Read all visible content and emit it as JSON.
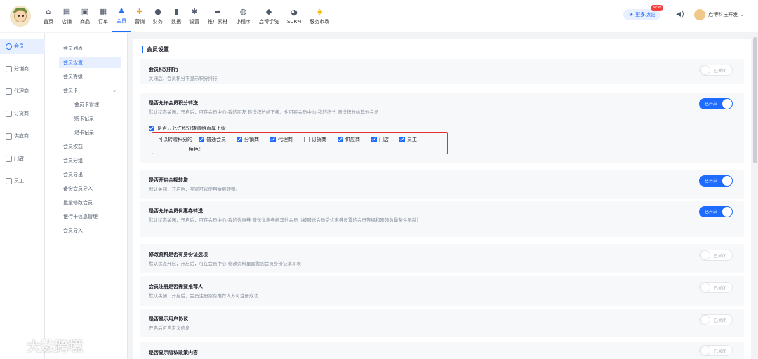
{
  "nav": [
    {
      "icon": "home-icon",
      "glyph": "⌂",
      "label": "首页"
    },
    {
      "icon": "store-icon",
      "glyph": "▤",
      "label": "店铺"
    },
    {
      "icon": "goods-icon",
      "glyph": "▣",
      "label": "商品"
    },
    {
      "icon": "order-icon",
      "glyph": "▦",
      "label": "订单"
    },
    {
      "icon": "member-icon",
      "glyph": "♟",
      "label": "会员",
      "active": true
    },
    {
      "icon": "marketing-icon",
      "glyph": "✚",
      "label": "营销"
    },
    {
      "icon": "finance-icon",
      "glyph": "●",
      "label": "财务"
    },
    {
      "icon": "data-icon",
      "glyph": "▮",
      "label": "数据"
    },
    {
      "icon": "settings-icon",
      "glyph": "✱",
      "label": "设置"
    },
    {
      "icon": "promote-icon",
      "glyph": "➦",
      "label": "推广素材"
    },
    {
      "icon": "miniapp-icon",
      "glyph": "◍",
      "label": "小程序"
    },
    {
      "icon": "academy-icon",
      "glyph": "◆",
      "label": "启博学院"
    },
    {
      "icon": "scrm-icon",
      "glyph": "◕",
      "label": "SCRM"
    },
    {
      "icon": "service-market-icon",
      "glyph": "◈",
      "label": "服务市场"
    }
  ],
  "top_right": {
    "more_label": "更多功能",
    "new_badge": "NEW",
    "user_name": "启博科技开发"
  },
  "side1": [
    {
      "label": "会员",
      "active": true
    },
    {
      "label": "分销商"
    },
    {
      "label": "代理商"
    },
    {
      "label": "订货商"
    },
    {
      "label": "供应商"
    },
    {
      "label": "门店"
    },
    {
      "label": "员工"
    }
  ],
  "side2": [
    {
      "label": "会员列表"
    },
    {
      "label": "会员设置",
      "active": true
    },
    {
      "label": "会员等级"
    },
    {
      "label": "会员卡",
      "expandable": true
    },
    {
      "label": "会员卡管理",
      "sub": true
    },
    {
      "label": "购卡记录",
      "sub": true
    },
    {
      "label": "退卡记录",
      "sub": true
    },
    {
      "label": "会员权益"
    },
    {
      "label": "会员分组"
    },
    {
      "label": "会员导出"
    },
    {
      "label": "备份会员导入"
    },
    {
      "label": "批量修改会员"
    },
    {
      "label": "银行卡信息管理"
    },
    {
      "label": "会员导入"
    }
  ],
  "section_title": "会员设置",
  "toggle_on_label": "已开启",
  "toggle_off_label": "已关闭",
  "settings": [
    {
      "title": "会员积分排行",
      "desc": "关闭后，会员积分不显示积分排行",
      "on": false
    },
    {
      "title": "是否允许会员积分转送",
      "desc": "默认状态关闭，开启后，可在会员中心-我的朋友 转送积分给下级，也可在会员中心-我的积分 赠送积分给其他会员",
      "on": true
    },
    {
      "title": "是否开启余额转增",
      "desc": "默认关闭，开启后，买家可以使用余额转赠。",
      "on": true
    },
    {
      "title": "是否允许会员优惠券转送",
      "desc": "默认状态关闭，开启后，可在会员中心-我的优惠券 赠送优惠券给其他会员（被赠送会员受优惠券设置的会员等级和限领数量条件限制）",
      "on": true
    },
    {
      "title": "修改资料是否有身份证选项",
      "desc": "默认状态开启，开启后，可在会员中心-修改资料里面看到会员身份证填写项",
      "on": false
    },
    {
      "title": "会员注册是否需要推荐人",
      "desc": "默认关闭，开启后，会员注册需有推荐人方可注册成功",
      "on": false
    },
    {
      "title": "是否显示用户协议",
      "desc": "开启后可自定义信息",
      "on": false
    },
    {
      "title": "是否显示隐私政策内容",
      "desc": "",
      "on": false
    }
  ],
  "transfer": {
    "only_direct_label": "是否只允许积分转赠给直属下级",
    "only_direct_checked": true,
    "roles_label": "可以转赠积分的",
    "roles_label2": "角色：",
    "roles": [
      {
        "label": "普通会员",
        "checked": true
      },
      {
        "label": "分销商",
        "checked": true
      },
      {
        "label": "代理商",
        "checked": true
      },
      {
        "label": "订货商",
        "checked": false
      },
      {
        "label": "供应商",
        "checked": true
      },
      {
        "label": "门店",
        "checked": true
      },
      {
        "label": "员工",
        "checked": true
      }
    ]
  },
  "watermark": "大数跨境",
  "colors": {
    "accent": "#1e6bff",
    "highlight_box": "#e03131"
  }
}
